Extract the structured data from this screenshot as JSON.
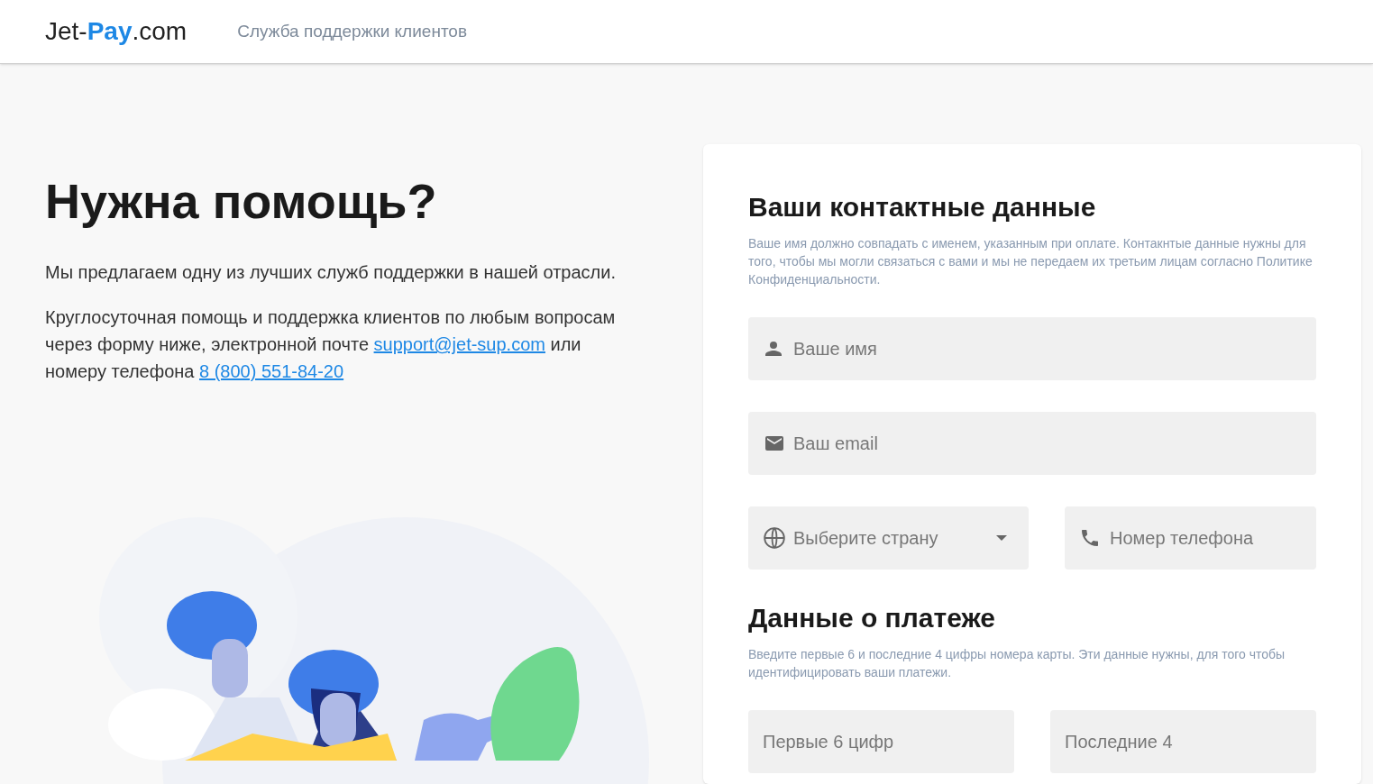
{
  "header": {
    "logo": "Jet-**Pay**.com",
    "nav_link": "Служба поддержки клиентов"
  },
  "intro": {
    "title": "Нужна помощь?",
    "paragraphs": [
      [
        {
          "kind": "text",
          "text": "Мы предлагаем одну из лучших служб поддержки в нашей отрасли."
        }
      ],
      [
        {
          "kind": "text",
          "text": "Круглосуточная помощь и поддержка клиентов по любым вопросам через форму ниже, электронной почте "
        },
        {
          "kind": "link",
          "text": "support@jet-sup.com"
        },
        {
          "kind": "text",
          "text": " или номеру телефона "
        },
        {
          "kind": "link",
          "text": "8 (800) 551-84-20"
        }
      ]
    ]
  },
  "form": {
    "sections": [
      {
        "title": "Ваши контактные данные",
        "note": "Ваше имя должно совпадать с именем, указанным при оплате. Контакнтые данные нужны для того, чтобы мы могли связаться с вами и мы не передаем их третьим лицам согласно Политике Конфиденциальности.",
        "rows": [
          [
            {
              "kind": "name",
              "placeholder": "Ваше имя"
            }
          ],
          [
            {
              "kind": "email",
              "placeholder": "Ваш email"
            }
          ],
          [
            {
              "kind": "country",
              "placeholder": "Выберите страну"
            },
            {
              "kind": "phone",
              "placeholder": "Номер телефона"
            }
          ]
        ]
      },
      {
        "title": "Данные о платеже",
        "note": "Введите первые 6 и последние 4 цифры номера карты. Эти данные нужны, для того чтобы идентифицировать ваши платежи.",
        "rows": [
          [
            {
              "kind": "card",
              "placeholder": "Первые 6 цифр"
            },
            {
              "kind": "card",
              "placeholder": "Последние 4"
            }
          ]
        ]
      }
    ]
  }
}
